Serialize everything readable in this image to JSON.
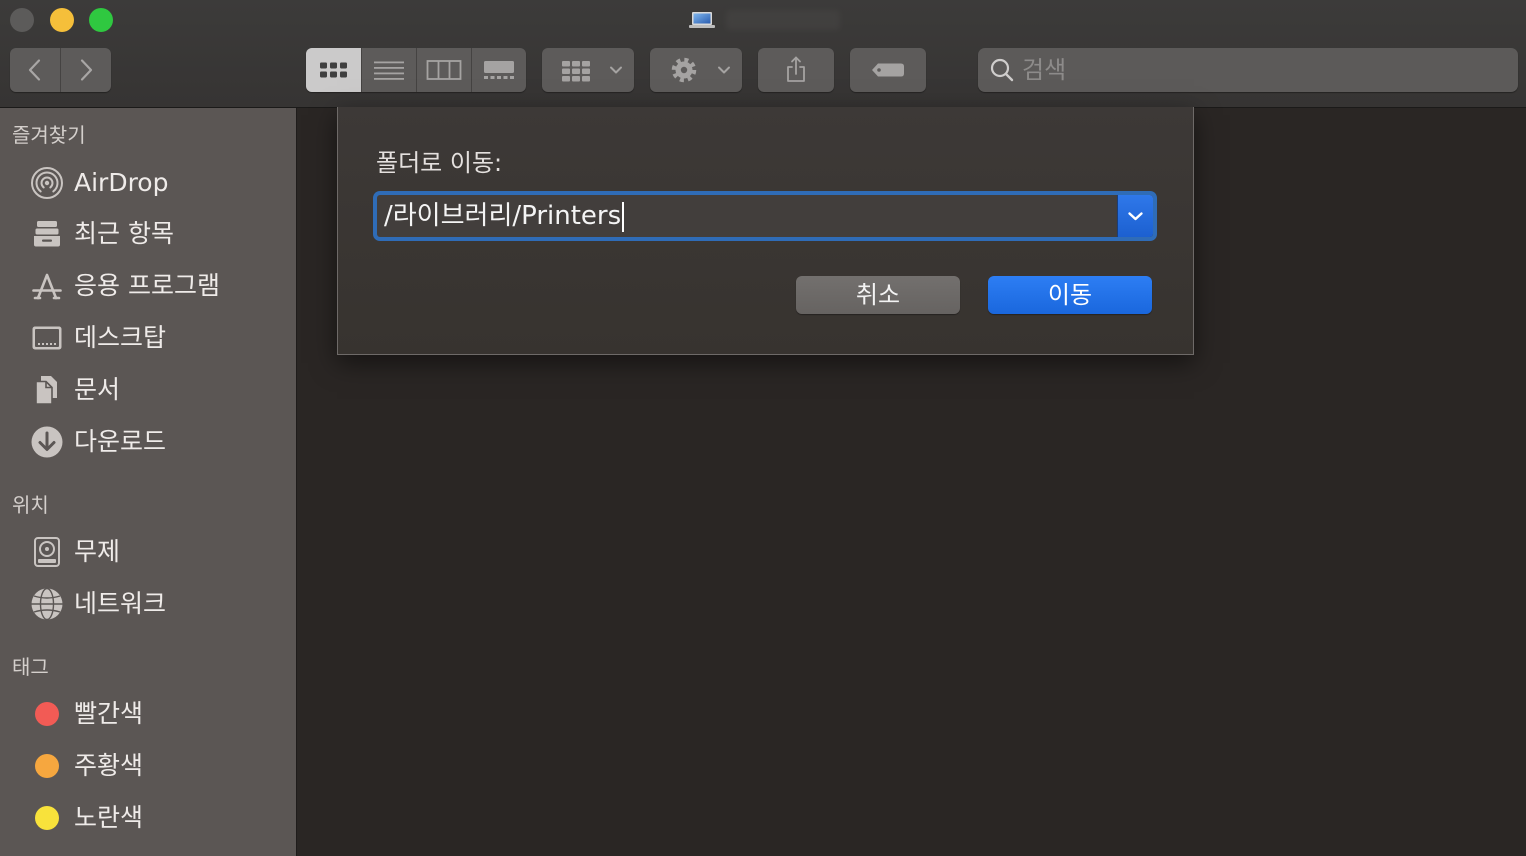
{
  "window": {
    "title_icon": "laptop-icon",
    "traffic_lights": {
      "close": "#5c5b5a",
      "minimize": "#f5bf3a",
      "zoom": "#2fc840"
    }
  },
  "toolbar": {
    "navigation": {
      "back_icon": "chevron-left-icon",
      "forward_icon": "chevron-right-icon"
    },
    "view_modes": [
      {
        "icon": "icon-view-icon",
        "selected": true
      },
      {
        "icon": "list-view-icon",
        "selected": false
      },
      {
        "icon": "column-view-icon",
        "selected": false
      },
      {
        "icon": "gallery-view-icon",
        "selected": false
      }
    ],
    "group_icon": "group-grid-icon",
    "action_icon": "gear-icon",
    "share_icon": "share-icon",
    "tag_icon": "tag-icon",
    "search": {
      "placeholder": "검색",
      "icon": "search-icon"
    }
  },
  "sidebar": {
    "sections": [
      {
        "title": "즐겨찾기",
        "items": [
          {
            "label": "AirDrop",
            "icon": "airdrop-icon"
          },
          {
            "label": "최근 항목",
            "icon": "recents-icon"
          },
          {
            "label": "응용 프로그램",
            "icon": "applications-icon"
          },
          {
            "label": "데스크탑",
            "icon": "desktop-icon"
          },
          {
            "label": "문서",
            "icon": "documents-icon"
          },
          {
            "label": "다운로드",
            "icon": "downloads-icon"
          }
        ]
      },
      {
        "title": "위치",
        "items": [
          {
            "label": "무제",
            "icon": "disk-icon"
          },
          {
            "label": "네트워크",
            "icon": "network-icon"
          }
        ]
      },
      {
        "title": "태그",
        "items": [
          {
            "label": "빨간색",
            "color": "#f25b55"
          },
          {
            "label": "주황색",
            "color": "#f6a73f"
          },
          {
            "label": "노란색",
            "color": "#f8e23b"
          }
        ]
      }
    ]
  },
  "dialog": {
    "label": "폴더로 이동:",
    "path_value": "/라이브러리/Printers",
    "dropdown_icon": "chevron-down-icon",
    "cancel_label": "취소",
    "go_label": "이동"
  },
  "colors": {
    "accent": "#1b6de4",
    "focus_ring": "#2f6cb7",
    "toolbar_bg": "#393736",
    "sidebar_bg": "#5b5654",
    "content_bg": "#2a2624"
  }
}
